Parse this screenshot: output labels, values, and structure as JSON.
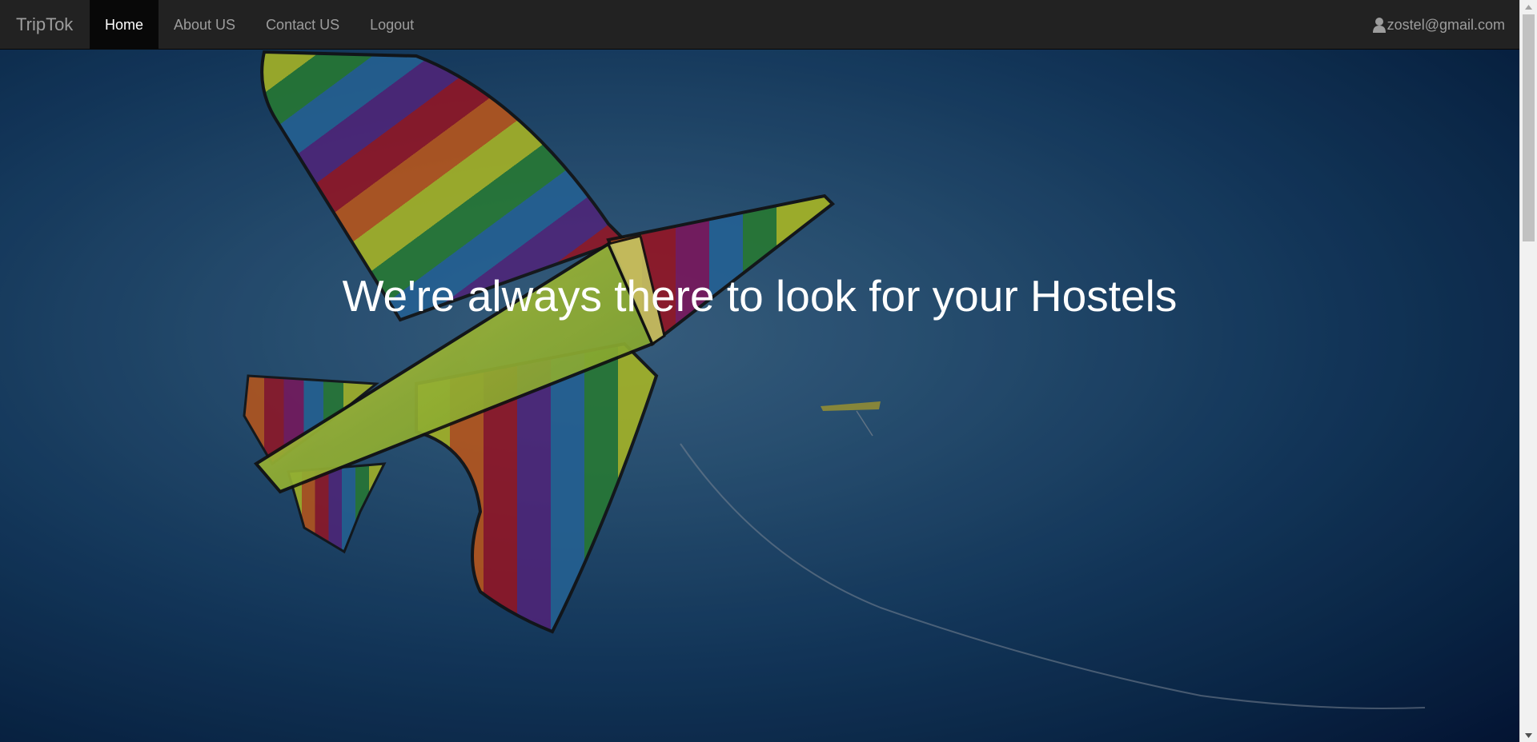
{
  "navbar": {
    "brand": "TripTok",
    "links": [
      {
        "label": "Home",
        "active": true
      },
      {
        "label": "About US",
        "active": false
      },
      {
        "label": "Contact US",
        "active": false
      },
      {
        "label": "Logout",
        "active": false
      }
    ],
    "user_email": "zostel@gmail.com",
    "user_icon": "user-icon"
  },
  "hero": {
    "headline": "We're always there to look for your Hostels",
    "background_image": "rainbow kite in blue sky"
  },
  "colors": {
    "navbar_bg": "#222222",
    "navbar_active_bg": "#080808",
    "nav_text": "#9d9d9d",
    "nav_text_active": "#ffffff",
    "sky": "#163e66"
  }
}
